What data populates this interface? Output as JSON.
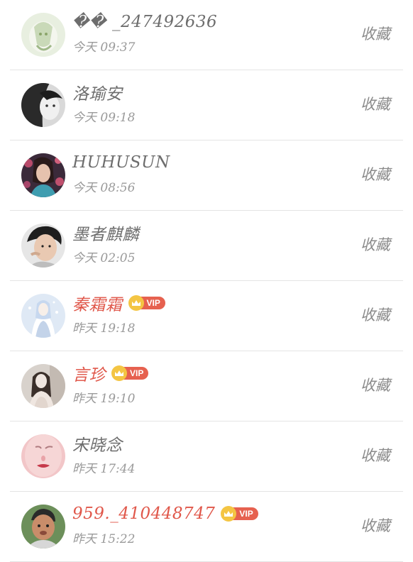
{
  "list": [
    {
      "name": "�� _247492636",
      "time": "今天 09:37",
      "action": "收藏",
      "vip": false,
      "avatar": "avatar-1",
      "palette": [
        "#e8efe0",
        "#c9d9b8",
        "#8aa46a"
      ]
    },
    {
      "name": "洛瑜安",
      "time": "今天 09:18",
      "action": "收藏",
      "vip": false,
      "avatar": "avatar-2",
      "palette": [
        "#d9d9d9",
        "#2a2a2a",
        "#f0f0f0"
      ]
    },
    {
      "name": "HUHUSUN",
      "time": "今天 08:56",
      "action": "收藏",
      "vip": false,
      "avatar": "avatar-3",
      "palette": [
        "#3b2a3a",
        "#b84a6a",
        "#3f9db0"
      ]
    },
    {
      "name": "墨者麒麟",
      "time": "今天 02:05",
      "action": "收藏",
      "vip": false,
      "avatar": "avatar-4",
      "palette": [
        "#e6e6e6",
        "#1e1e1e",
        "#e9c9b2"
      ]
    },
    {
      "name": "秦霜霜",
      "time": "昨天 19:18",
      "action": "收藏",
      "vip": true,
      "vip_label": "VIP",
      "avatar": "avatar-5",
      "palette": [
        "#dfe9f5",
        "#a9c1e0",
        "#ffffff"
      ]
    },
    {
      "name": "言珍",
      "time": "昨天 19:10",
      "action": "收藏",
      "vip": true,
      "vip_label": "VIP",
      "avatar": "avatar-6",
      "palette": [
        "#d8d2cc",
        "#3a2f2a",
        "#efe6e0"
      ]
    },
    {
      "name": "宋晓念",
      "time": "昨天 17:44",
      "action": "收藏",
      "vip": false,
      "avatar": "avatar-7",
      "palette": [
        "#f2c6c8",
        "#e9a3a8",
        "#c63a4b"
      ]
    },
    {
      "name": "959._410448747",
      "time": "昨天 15:22",
      "action": "收藏",
      "vip": true,
      "vip_label": "VIP",
      "avatar": "avatar-8",
      "palette": [
        "#6c8f5a",
        "#2a2a2a",
        "#c98d6a"
      ]
    }
  ]
}
